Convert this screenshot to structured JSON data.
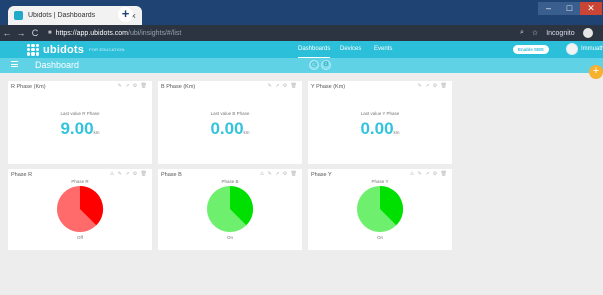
{
  "browser": {
    "tab_title": "Ubidots | Dashboards",
    "tab_close": "×",
    "new_tab": "+",
    "url_host": "https://app.ubidots.com",
    "url_path": "/ubi/insights/#/list",
    "profile_label": "Incognito",
    "window_buttons": [
      "–",
      "□",
      "✕"
    ]
  },
  "app": {
    "logo_text": "ubidots",
    "logo_subtitle": "FOR EDUCATION",
    "nav": [
      "Dashboards",
      "Devices",
      "Events"
    ],
    "enable_button": "Enable SMS",
    "username": "Immuathi"
  },
  "dashboard": {
    "title": "Dashboard",
    "add_button": "+"
  },
  "value_widgets": [
    {
      "title": "R Phase (Km)",
      "caption": "Last value R Phase",
      "value": "9.00",
      "unit": "km"
    },
    {
      "title": "B Phase (Km)",
      "caption": "Last value B Phase",
      "value": "0.00",
      "unit": "km"
    },
    {
      "title": "Y Phase (Km)",
      "caption": "Last value Y Phase",
      "value": "0.00",
      "unit": "km"
    }
  ],
  "indicator_widgets": [
    {
      "title": "Phase R",
      "label": "Phase R",
      "state": "Off",
      "color": "#ff0000",
      "shade": "#ff6b6b"
    },
    {
      "title": "Phase B",
      "label": "Phase B",
      "state": "On",
      "color": "#00e000",
      "shade": "#6ef06e"
    },
    {
      "title": "Phase Y",
      "label": "Phase Y",
      "state": "On",
      "color": "#00e000",
      "shade": "#6ef06e"
    }
  ],
  "colors": {
    "header": "#2bbfd9",
    "dashbar": "#5fd2e6",
    "value": "#32c4dc",
    "fab": "#f6b12e"
  }
}
